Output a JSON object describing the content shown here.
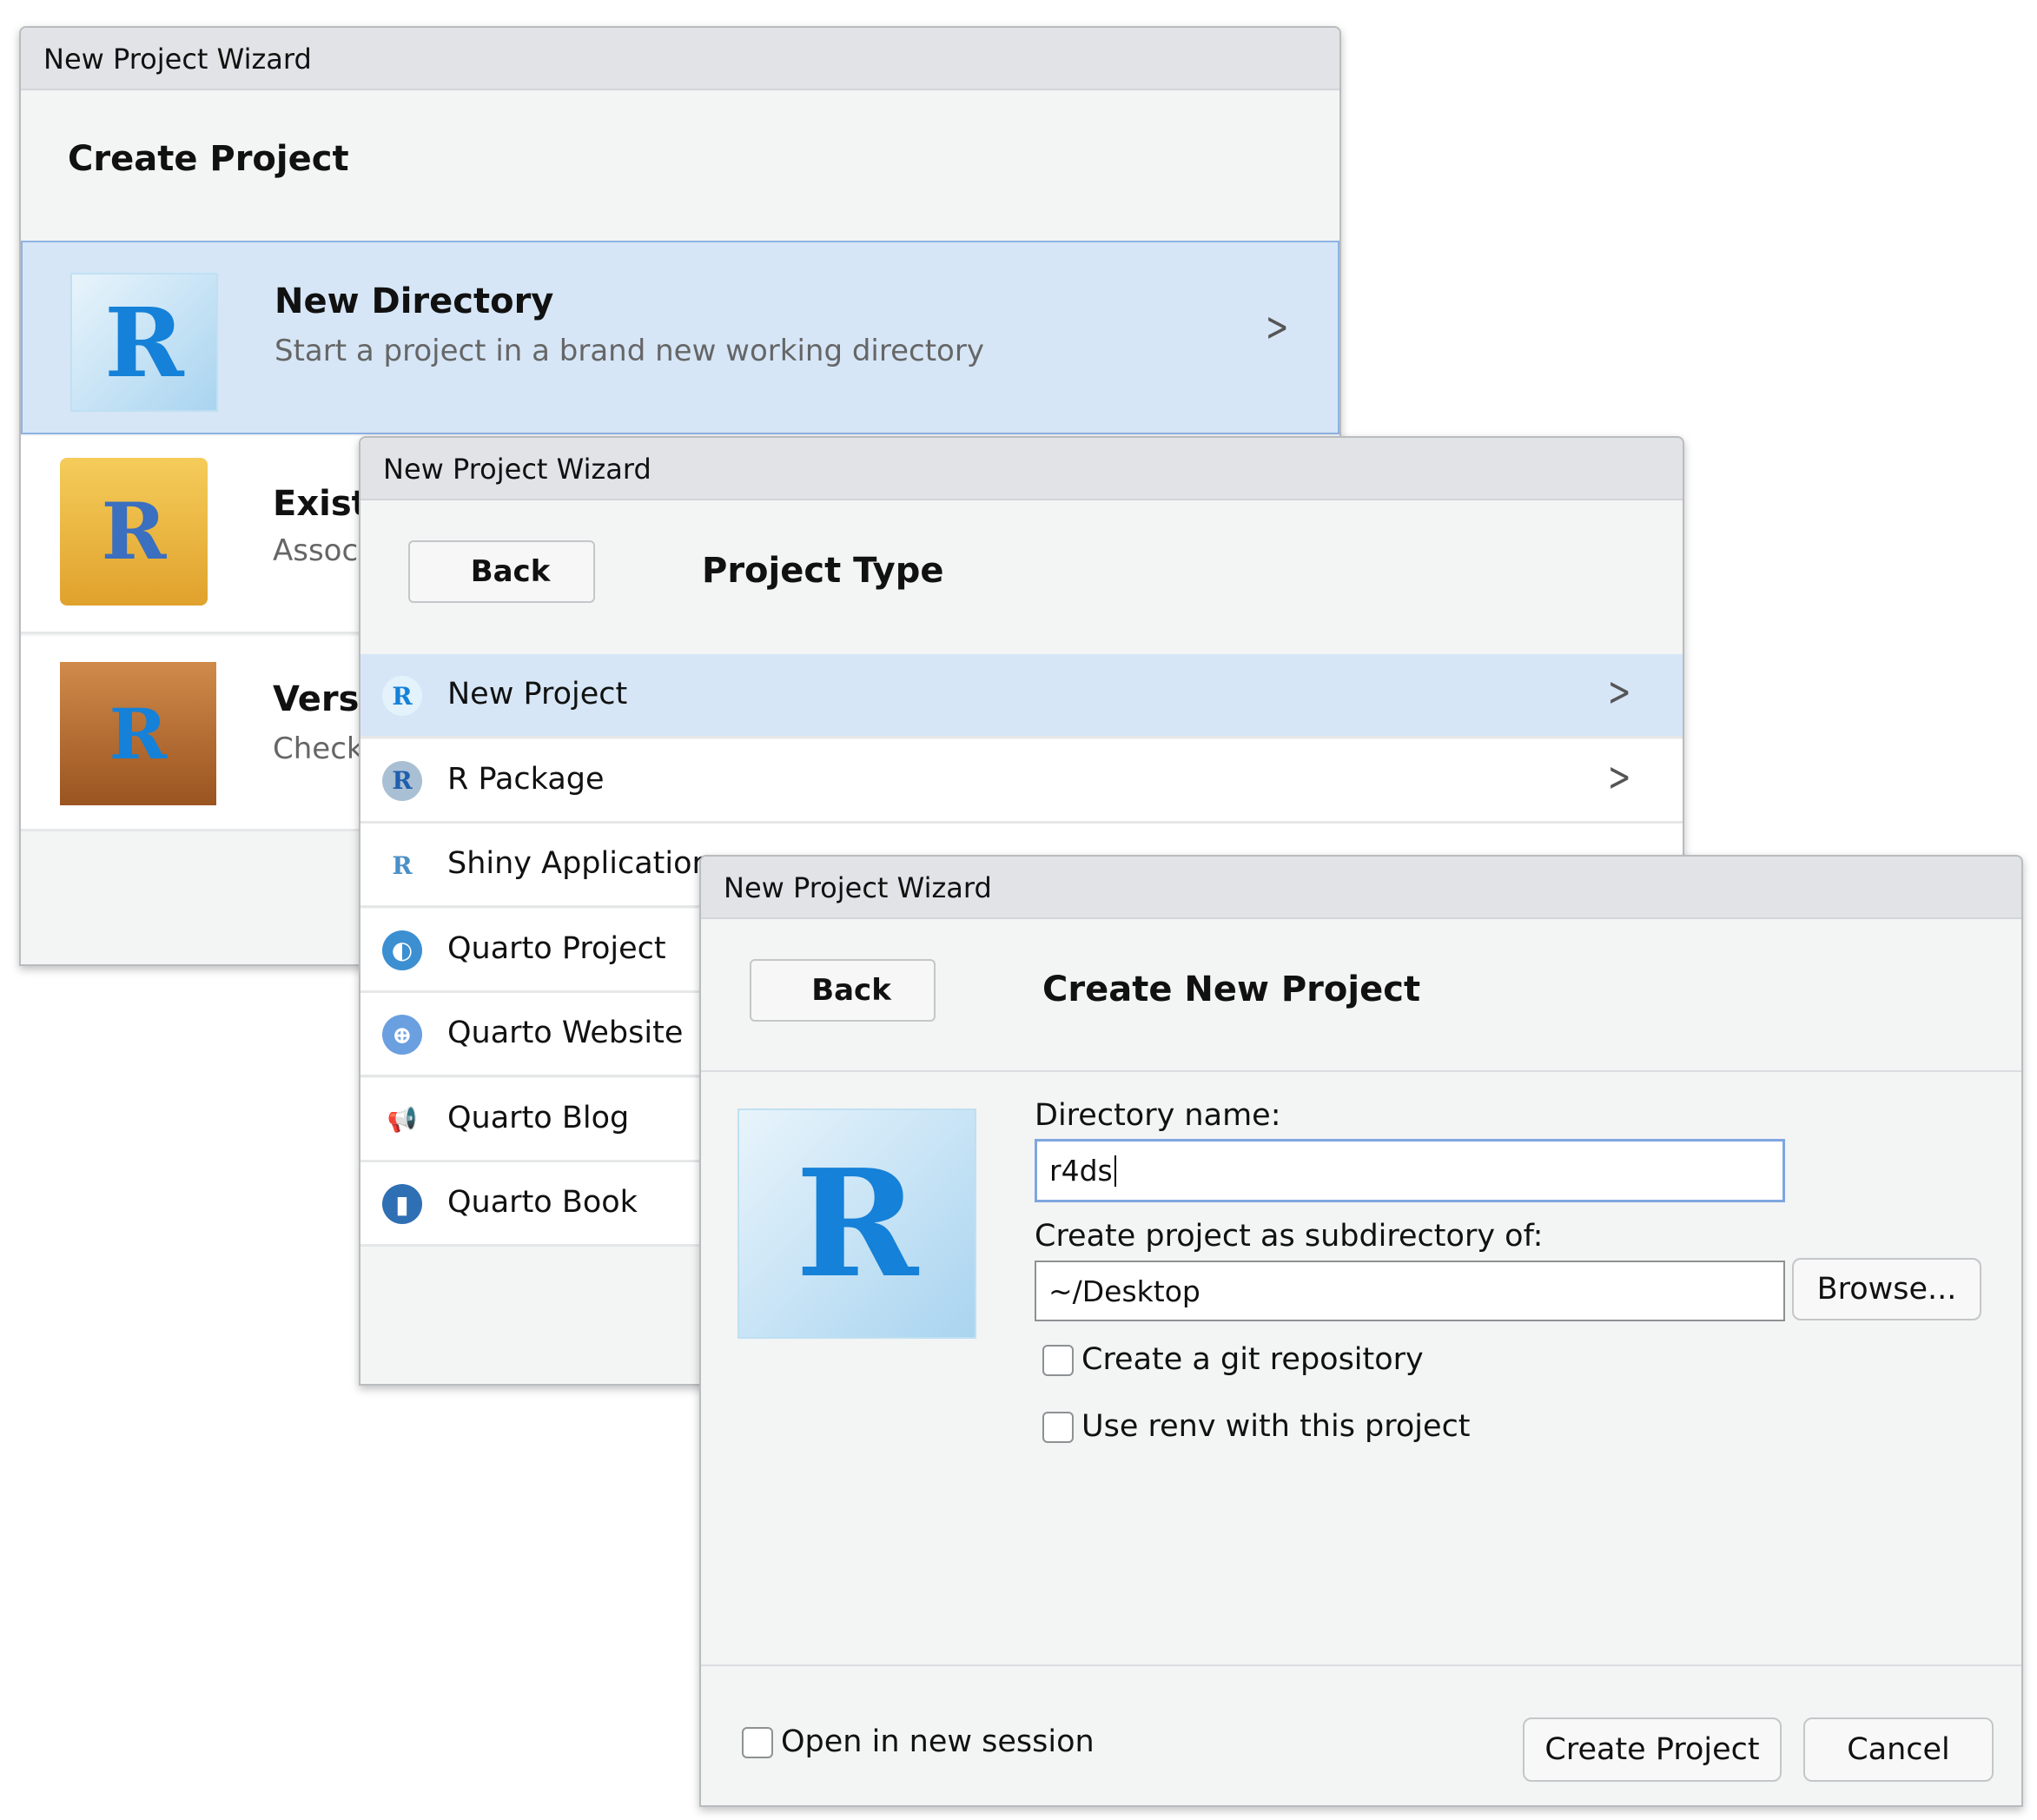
{
  "window1": {
    "title": "New Project Wizard",
    "heading": "Create Project",
    "options": [
      {
        "title": "New Directory",
        "subtitle": "Start a project in a brand new working directory",
        "icon": "r-cube-icon"
      },
      {
        "title": "Exist",
        "subtitle": "Assoc",
        "icon": "folder-r-icon"
      },
      {
        "title": "Vers",
        "subtitle": "Check",
        "icon": "box-r-icon"
      }
    ]
  },
  "window2": {
    "title": "New Project Wizard",
    "back": "Back",
    "heading": "Project Type",
    "items": [
      {
        "label": "New Project",
        "icon": "r-cube-icon"
      },
      {
        "label": "R Package",
        "icon": "r-package-icon"
      },
      {
        "label": "Shiny Application",
        "icon": "shiny-icon"
      },
      {
        "label": "Quarto Project",
        "icon": "quarto-icon"
      },
      {
        "label": "Quarto Website",
        "icon": "globe-icon"
      },
      {
        "label": "Quarto Blog",
        "icon": "megaphone-icon"
      },
      {
        "label": "Quarto Book",
        "icon": "book-icon"
      }
    ]
  },
  "window3": {
    "title": "New Project Wizard",
    "back": "Back",
    "heading": "Create New Project",
    "dir_label": "Directory name:",
    "dir_value": "r4ds",
    "parent_label": "Create project as subdirectory of:",
    "parent_value": "~/Desktop",
    "browse": "Browse...",
    "git": "Create a git repository",
    "renv": "Use renv with this project",
    "new_session": "Open in new session",
    "create": "Create Project",
    "cancel": "Cancel"
  },
  "colors": {
    "selection": "#d6e6f7",
    "focus": "#7fa6e0",
    "r_blue": "#1581d8"
  }
}
